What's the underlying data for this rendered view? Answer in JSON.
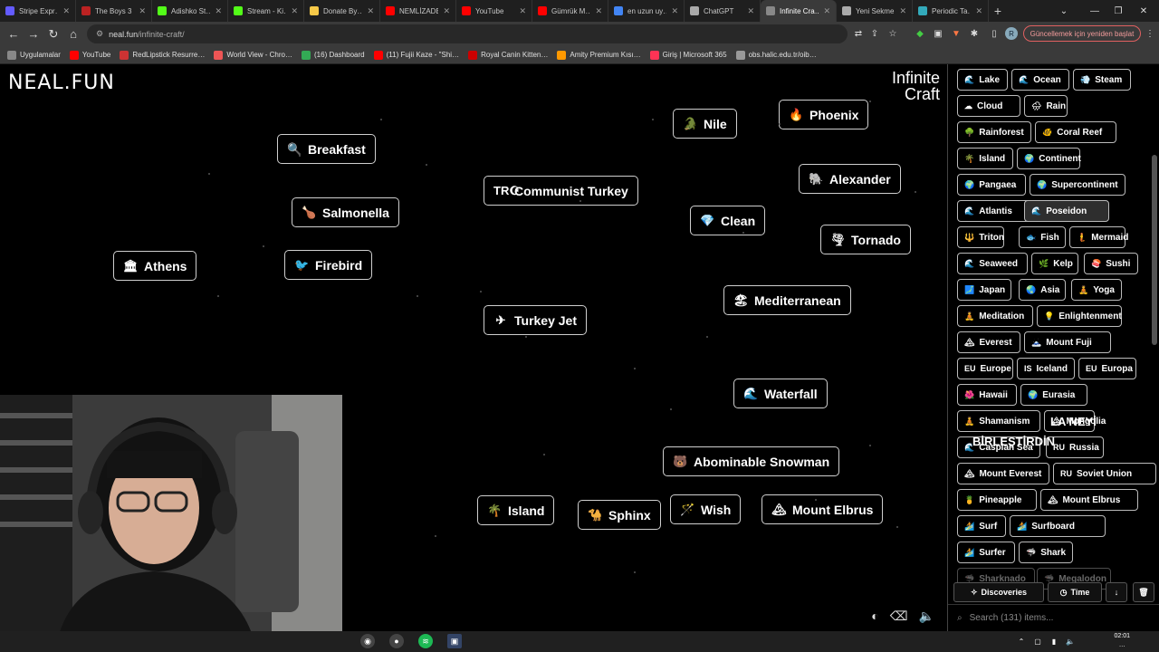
{
  "browser": {
    "tabs": [
      {
        "title": "Stripe Expr…",
        "color": "#635bff"
      },
      {
        "title": "The Boys 3",
        "color": "#b22"
      },
      {
        "title": "Adishko St…",
        "color": "#53fc18"
      },
      {
        "title": "Stream - Ki…",
        "color": "#53fc18"
      },
      {
        "title": "Donate By…",
        "color": "#f7c948"
      },
      {
        "title": "NEMLİZADE",
        "color": "#f00"
      },
      {
        "title": "YouTube",
        "color": "#f00"
      },
      {
        "title": "Gümrük M…",
        "color": "#f00"
      },
      {
        "title": "en uzun uy…",
        "color": "#4285f4"
      },
      {
        "title": "ChatGPT",
        "color": "#aaa"
      },
      {
        "title": "Infinite Cra…",
        "color": "#888",
        "active": true
      },
      {
        "title": "Yeni Sekme",
        "color": "#aaa"
      },
      {
        "title": "Periodic Ta…",
        "color": "#3ab"
      }
    ],
    "url_host": "neal.fun",
    "url_path": "/infinite-craft/",
    "update_label": "Güncellemek için yeniden başlat",
    "profile_initial": "R",
    "bookmarks": [
      {
        "label": "Uygulamalar",
        "color": "#888"
      },
      {
        "label": "YouTube",
        "color": "#f00"
      },
      {
        "label": "RedLipstick Resurre…",
        "color": "#c33"
      },
      {
        "label": "World View - Chro…",
        "color": "#e55"
      },
      {
        "label": "(16) Dashboard",
        "color": "#3a5"
      },
      {
        "label": "(11) Fujii Kaze - \"Shi…",
        "color": "#f00"
      },
      {
        "label": "Royal Canin Kitten…",
        "color": "#c00"
      },
      {
        "label": "Amity Premium Kısı…",
        "color": "#f90"
      },
      {
        "label": "Giriş | Microsoft 365",
        "color": "#f35"
      },
      {
        "label": "obs.halic.edu.tr/oib…",
        "color": "#999"
      }
    ]
  },
  "game": {
    "logo": "NEAL.FUN",
    "title_line1": "Infinite",
    "title_line2": "Craft",
    "canvas_items": [
      {
        "emoji": "🔍",
        "label": "Breakfast"
      },
      {
        "emoji": "TR☪",
        "label": "Communist Turkey"
      },
      {
        "emoji": "🐊",
        "label": "Nile"
      },
      {
        "emoji": "🔥",
        "label": "Phoenix"
      },
      {
        "emoji": "🐘",
        "label": "Alexander"
      },
      {
        "emoji": "🍗",
        "label": "Salmonella"
      },
      {
        "emoji": "💎",
        "label": "Clean"
      },
      {
        "emoji": "🌪",
        "label": "Tornado"
      },
      {
        "emoji": "🏛",
        "label": "Athens"
      },
      {
        "emoji": "🐦",
        "label": "Firebird"
      },
      {
        "emoji": "🏖",
        "label": "Mediterranean"
      },
      {
        "emoji": "✈",
        "label": "Turkey Jet"
      },
      {
        "emoji": "🌊",
        "label": "Waterfall"
      },
      {
        "emoji": "🐻",
        "label": "Abominable Snowman"
      },
      {
        "emoji": "🌴",
        "label": "Island"
      },
      {
        "emoji": "🐪",
        "label": "Sphinx"
      },
      {
        "emoji": "🪄",
        "label": "Wish"
      },
      {
        "emoji": "🏔",
        "label": "Mount Elbrus"
      }
    ],
    "sidebar_items": [
      {
        "emoji": "🌊",
        "label": "Lake"
      },
      {
        "emoji": "🌊",
        "label": "Ocean"
      },
      {
        "emoji": "💨",
        "label": "Steam"
      },
      {
        "emoji": "☁",
        "label": "Cloud"
      },
      {
        "emoji": "🌧",
        "label": "Rain"
      },
      {
        "emoji": "🌳",
        "label": "Rainforest"
      },
      {
        "emoji": "🐠",
        "label": "Coral Reef"
      },
      {
        "emoji": "🌴",
        "label": "Island"
      },
      {
        "emoji": "🌍",
        "label": "Continent"
      },
      {
        "emoji": "🌍",
        "label": "Pangaea"
      },
      {
        "emoji": "🌍",
        "label": "Supercontinent"
      },
      {
        "emoji": "🌊",
        "label": "Atlantis"
      },
      {
        "emoji": "🌊",
        "label": "Poseidon"
      },
      {
        "emoji": "🔱",
        "label": "Triton"
      },
      {
        "emoji": "🐟",
        "label": "Fish"
      },
      {
        "emoji": "🧜",
        "label": "Mermaid"
      },
      {
        "emoji": "🌊",
        "label": "Seaweed"
      },
      {
        "emoji": "🌿",
        "label": "Kelp"
      },
      {
        "emoji": "🍣",
        "label": "Sushi"
      },
      {
        "emoji": "🗾",
        "label": "Japan"
      },
      {
        "emoji": "🌏",
        "label": "Asia"
      },
      {
        "emoji": "🧘",
        "label": "Yoga"
      },
      {
        "emoji": "🧘",
        "label": "Meditation"
      },
      {
        "emoji": "💡",
        "label": "Enlightenment"
      },
      {
        "emoji": "🏔",
        "label": "Everest"
      },
      {
        "emoji": "🗻",
        "label": "Mount Fuji"
      },
      {
        "emoji": "EU",
        "label": "Europe"
      },
      {
        "emoji": "IS",
        "label": "Iceland"
      },
      {
        "emoji": "EU",
        "label": "Europa"
      },
      {
        "emoji": "🌺",
        "label": "Hawaii"
      },
      {
        "emoji": "🌍",
        "label": "Eurasia"
      },
      {
        "emoji": "🧘",
        "label": "Shamanism"
      },
      {
        "emoji": "🏔",
        "label": "Mongolia"
      },
      {
        "emoji": "🌊",
        "label": "Caspian Sea"
      },
      {
        "emoji": "RU",
        "label": "Russia"
      },
      {
        "emoji": "🏔",
        "label": "Mount Everest"
      },
      {
        "emoji": "RU",
        "label": "Soviet Union"
      },
      {
        "emoji": "🍍",
        "label": "Pineapple"
      },
      {
        "emoji": "🏔",
        "label": "Mount Elbrus"
      },
      {
        "emoji": "🏄",
        "label": "Surf"
      },
      {
        "emoji": "🏄",
        "label": "Surfboard"
      },
      {
        "emoji": "🏄",
        "label": "Surfer"
      },
      {
        "emoji": "🦈",
        "label": "Shark"
      },
      {
        "emoji": "🦈",
        "label": "Sharknado"
      },
      {
        "emoji": "🦈",
        "label": "Megalodon"
      }
    ],
    "overlay_line1": "LA NEYİ",
    "overlay_line2": "BİRLEŞTİRDİN",
    "controls": {
      "discoveries": "Discoveries",
      "time": "Time",
      "sort_icon": "↓",
      "trash_icon": "🗑"
    },
    "search_placeholder": "Search (131) items..."
  },
  "taskbar": {
    "time": "02:01",
    "date": "…"
  }
}
